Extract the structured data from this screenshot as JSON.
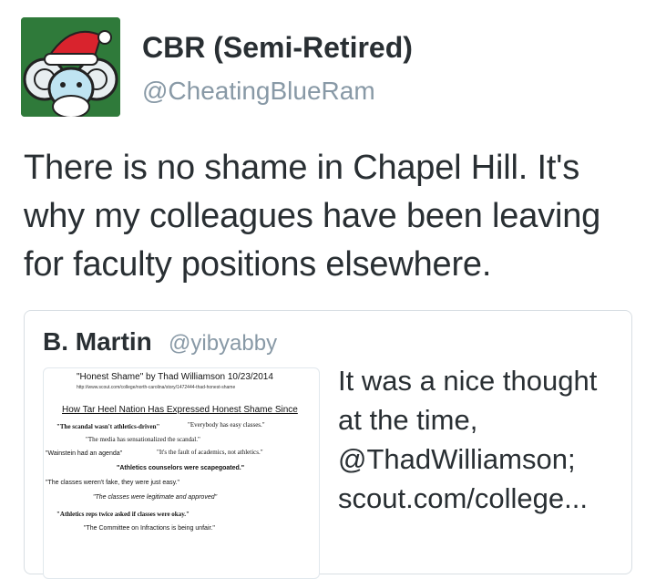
{
  "user": {
    "name": "CBR (Semi-Retired)",
    "handle": "@CheatingBlueRam",
    "avatar_icon": "ram-santa-hat-avatar"
  },
  "tweet": {
    "text": "There is no shame in Chapel Hill. It's why my colleagues have been leaving for faculty positions elsewhere."
  },
  "quoted": {
    "name": "B. Martin",
    "handle": "@yibyabby",
    "text": "It was a nice thought at the time, @ThadWilliamson; scout.com/college...",
    "image": {
      "title": "\"Honest Shame\" by Thad Williamson 10/23/2014",
      "url": "http://www.scout.com/college/north-carolina/story/1472444-thad-honest-shame",
      "heading": "How Tar Heel Nation Has Expressed Honest Shame Since",
      "quotes": [
        "\"The scandal wasn't athletics-driven\"",
        "\"Everybody has easy classes.\"",
        "\"The media has sensationalized the scandal.\"",
        "\"Wainstein had an agenda\"",
        "\"It's the fault of academics, not athletics.\"",
        "\"Athletics counselors were scapegoated.\"",
        "\"The classes weren't fake, they were just easy.\"",
        "\"The classes were legitimate and approved\"",
        "\"Athletics reps twice asked if classes were okay.\"",
        "\"The Committee on Infractions is being unfair.\""
      ]
    }
  },
  "colors": {
    "text": "#292f33",
    "muted": "#8899a6",
    "border": "#d8dee3",
    "avatar_bg": "#2f7a3a"
  }
}
